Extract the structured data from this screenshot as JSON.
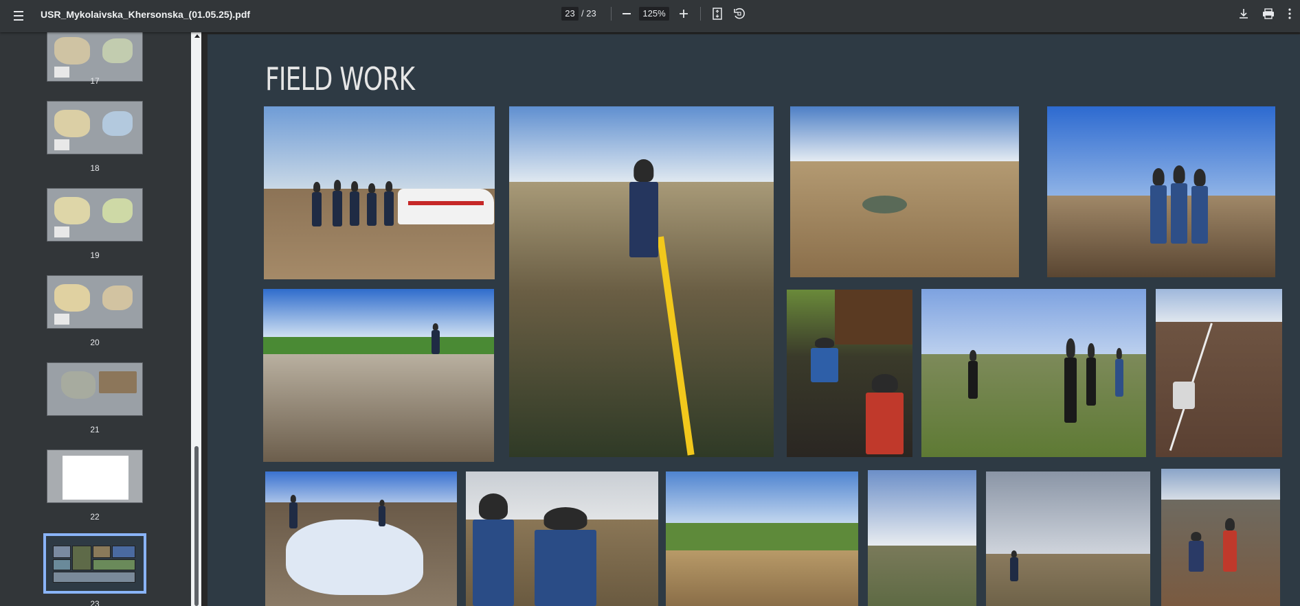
{
  "toolbar": {
    "title": "USR_Mykolaivska_Khersonska_(01.05.25).pdf",
    "current_page": "23",
    "total_pages": "/ 23",
    "zoom": "125%",
    "icons": [
      "menu-icon",
      "zoom-out-icon",
      "zoom-in-icon",
      "fit-page-icon",
      "rotate-icon",
      "download-icon",
      "print-icon",
      "more-vert-icon"
    ]
  },
  "sidebar": {
    "thumbnails": [
      {
        "label": "17"
      },
      {
        "label": "18"
      },
      {
        "label": "19"
      },
      {
        "label": "20"
      },
      {
        "label": "21"
      },
      {
        "label": "22"
      },
      {
        "label": "23",
        "selected": true
      }
    ]
  },
  "page": {
    "heading": "FIELD WORK",
    "background_color": "#2e3a44",
    "photo_count": 17
  }
}
